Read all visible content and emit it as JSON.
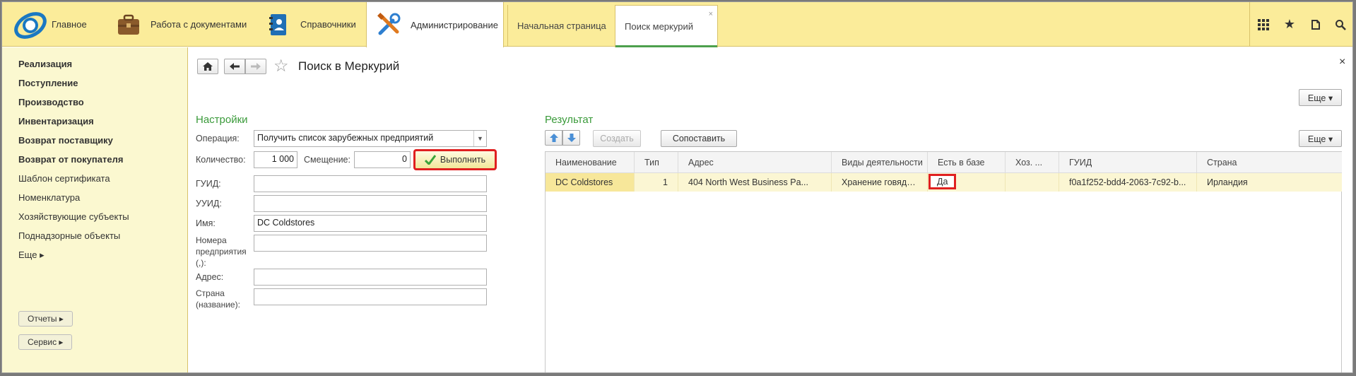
{
  "topbar": {
    "sections": [
      {
        "label": "Главное"
      },
      {
        "label": "Работа с документами"
      },
      {
        "label": "Справочники"
      },
      {
        "label": "Администрирование"
      }
    ],
    "tabs": [
      {
        "label": "Начальная страница"
      },
      {
        "label": "Поиск меркурий",
        "close": "×"
      }
    ],
    "tools": [
      "apps-icon",
      "star-icon",
      "history-icon",
      "search-icon"
    ]
  },
  "sidebar": {
    "items": [
      {
        "label": "Реализация"
      },
      {
        "label": "Поступление"
      },
      {
        "label": "Производство"
      },
      {
        "label": "Инвентаризация"
      },
      {
        "label": "Возврат поставщику"
      },
      {
        "label": "Возврат от покупателя"
      },
      {
        "label": "Шаблон сертификата"
      },
      {
        "label": "Номенклатура"
      },
      {
        "label": "Хозяйствующие субъекты"
      },
      {
        "label": "Поднадзорные объекты"
      },
      {
        "label": "Еще ▸"
      }
    ],
    "buttons": [
      {
        "label": "Отчеты ▸"
      },
      {
        "label": "Сервис ▸"
      }
    ]
  },
  "form": {
    "title": "Поиск в Меркурий",
    "close": "×",
    "more": "Еще ▾",
    "settings": {
      "heading": "Настройки",
      "operation_label": "Операция:",
      "operation_value": "Получить список зарубежных предприятий",
      "count_label": "Количество:",
      "count_value": "1 000",
      "offset_label": "Смещение:",
      "offset_value": "0",
      "execute_label": "Выполнить",
      "guid_label": "ГУИД:",
      "guid_value": "",
      "uuid_label": "УУИД:",
      "uuid_value": "",
      "name_label": "Имя:",
      "name_value": "DC Coldstores",
      "numbers_label_1": "Номера",
      "numbers_label_2": "предприятия",
      "numbers_label_3": "(,):",
      "numbers_value": "",
      "address_label": "Адрес:",
      "address_value": "",
      "country_label_1": "Страна",
      "country_label_2": "(название):",
      "country_value": ""
    },
    "result": {
      "heading": "Результат",
      "create_label": "Создать",
      "match_label": "Сопоставить",
      "more": "Еще ▾",
      "columns": [
        "Наименование",
        "Тип",
        "Адрес",
        "Виды деятельности",
        "Есть в базе",
        "Хоз. ...",
        "ГУИД",
        "Страна"
      ],
      "rows": [
        [
          "DC Coldstores",
          "1",
          "404 North West Business Pa...",
          "Хранение говядины...",
          "Да",
          "",
          "f0a1f252-bdd4-2063-7c92-b...",
          "Ирландия"
        ]
      ]
    }
  },
  "colors": {
    "topbar": "#fbec9a",
    "sidebar": "#fbf8d0",
    "accent_green": "#3a9a3a",
    "highlight_red": "#e02020",
    "row_selected": "#fbf6d3"
  }
}
